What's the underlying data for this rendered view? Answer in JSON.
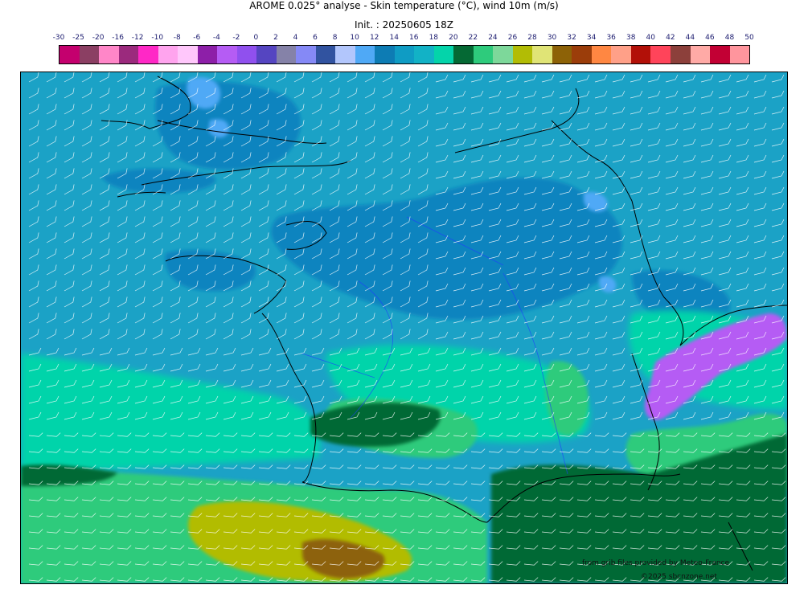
{
  "header": {
    "title": "AROME 0.025° analyse - Skin temperature (°C), wind 10m (m/s)",
    "init": "Init. : 20250605 18Z"
  },
  "legend": {
    "labels": [
      "-30",
      "-25",
      "-20",
      "-16",
      "-12",
      "-10",
      "-8",
      "-6",
      "-4",
      "-2",
      "0",
      "2",
      "4",
      "6",
      "8",
      "10",
      "12",
      "14",
      "16",
      "18",
      "20",
      "22",
      "24",
      "26",
      "28",
      "30",
      "32",
      "34",
      "36",
      "38",
      "40",
      "42",
      "44",
      "46",
      "48",
      "50"
    ],
    "colors": [
      "#c4006e",
      "#8b3f63",
      "#ff86c8",
      "#9b2a7d",
      "#ff28c6",
      "#ffa4ee",
      "#ffc7fb",
      "#8d1fa8",
      "#b55cf4",
      "#9050ee",
      "#5545c1",
      "#8582a8",
      "#8589f6",
      "#3153a0",
      "#b2c6fc",
      "#4fa9f6",
      "#0d7cb4",
      "#0f9cc4",
      "#12b2c6",
      "#04d4aa",
      "#056934",
      "#2ecb7c",
      "#7dd89a",
      "#b2bc05",
      "#e0e476",
      "#8d6207",
      "#9b3d0a",
      "#ff8742",
      "#ffa088",
      "#b21008",
      "#ff445a",
      "#8c403b",
      "#ffaaa6",
      "#c20034",
      "#ff959d"
    ]
  },
  "map": {
    "ocean_color": "#1ba2c6",
    "cool_land_color": "#0f84bf",
    "cold_color": "#4fa9f6",
    "warm_color": "#04d4aa",
    "hot_color": "#2ecb7c",
    "very_hot_color": "#056934",
    "mountain_color": "#b55cf4",
    "desert_color": "#b2bc05",
    "brown_color": "#8d6207"
  },
  "credits": {
    "source": "from grib files provided by Meteo-France",
    "copyright": "©2025 sbcnzone.net"
  }
}
